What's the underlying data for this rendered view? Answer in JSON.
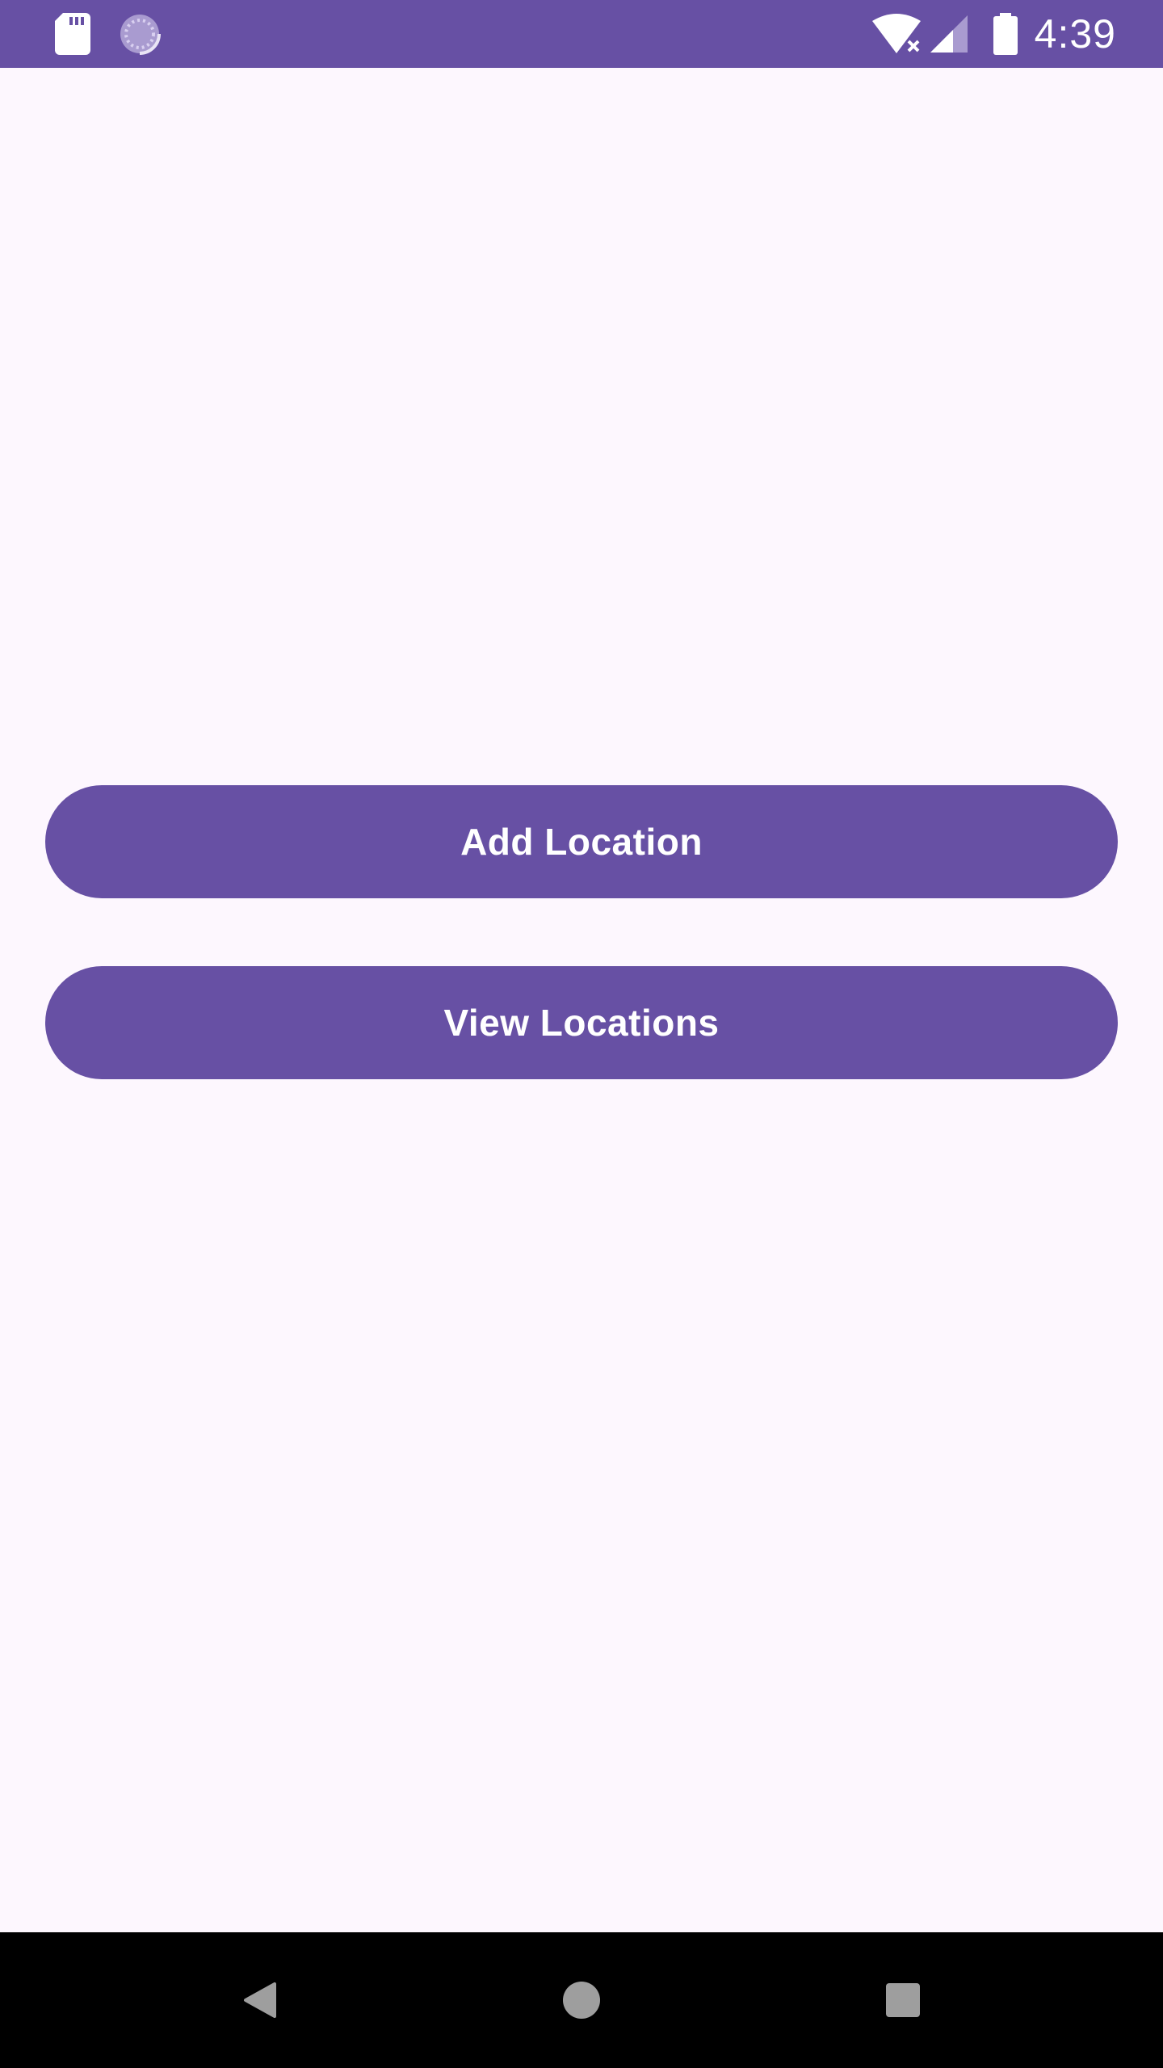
{
  "status_bar": {
    "time": "4:39",
    "icons": [
      "sd-card-icon",
      "sync-icon",
      "wifi-off-icon",
      "cell-signal-icon",
      "battery-icon"
    ],
    "background_color": "#6750a4"
  },
  "main": {
    "add_location_label": "Add Location",
    "view_locations_label": "View Locations",
    "button_color": "#6750a4",
    "background_color": "#fdf7fe"
  },
  "nav_bar": {
    "icons": [
      "back-icon",
      "home-icon",
      "recents-icon"
    ]
  }
}
